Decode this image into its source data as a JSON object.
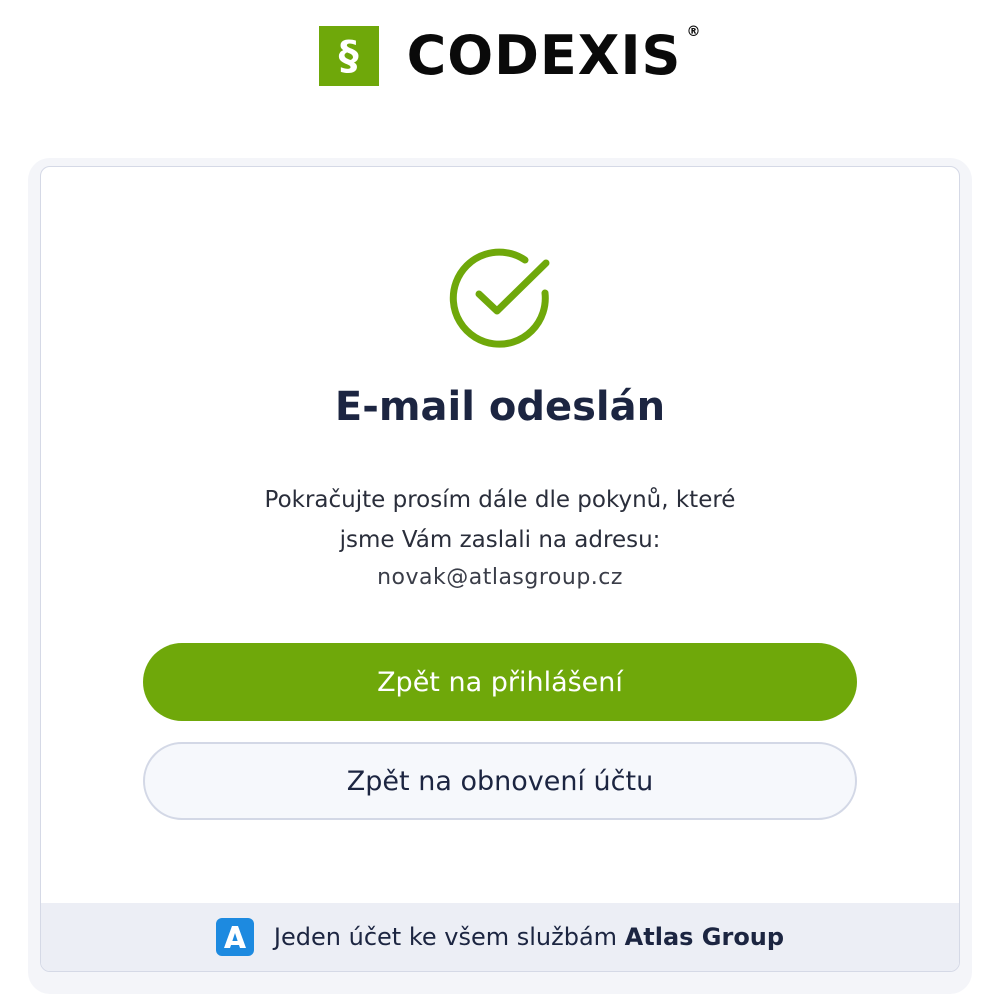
{
  "logo": {
    "symbol": "§",
    "word": "CODEXIS",
    "registered": "®",
    "brand_color": "#6fa80a"
  },
  "card": {
    "icon": "check-circle-icon",
    "title": "E-mail odeslán",
    "message_line1": "Pokračujte prosím dále dle pokynů, které",
    "message_line2": "jsme Vám zaslali na adresu:",
    "email": "novak@atlasgroup.cz",
    "primary_button": "Zpět na přihlášení",
    "secondary_button": "Zpět na obnovení účtu"
  },
  "footer": {
    "icon": "atlas-logo-icon",
    "text": "Jeden účet ke všem službám",
    "brand": "Atlas Group",
    "icon_color": "#1d8ae0"
  },
  "colors": {
    "accent": "#6fa80a",
    "title": "#1c2541",
    "footer_bg": "#eceef5"
  }
}
